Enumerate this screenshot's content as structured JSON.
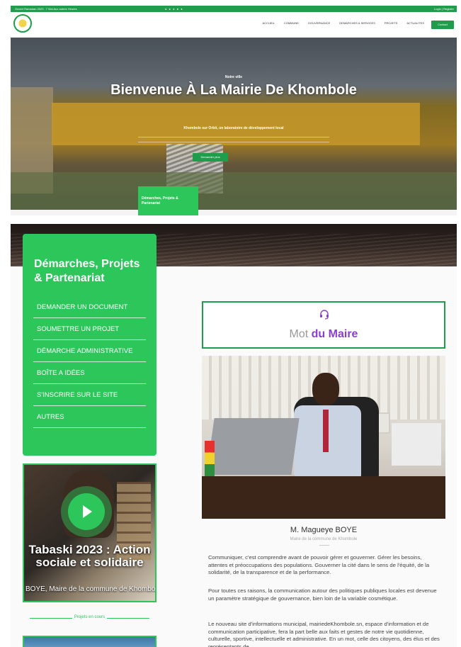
{
  "topbar": {
    "left_text": "Ouvert Ramadan 2023 : 7 Mai Aux autres Heures",
    "social_icons": [
      "facebook-icon",
      "twitter-icon",
      "instagram-icon",
      "youtube-icon",
      "linkedin-icon"
    ],
    "right_text": "Login | Register"
  },
  "navbar": {
    "items": [
      "ACCUEIL",
      "COMMUNE",
      "GOUVERNANCE",
      "DEMARCHES & SERVICES",
      "PROJETS",
      "ACTUALITES"
    ],
    "cta_label": "Contact"
  },
  "hero": {
    "small_title": "Notre ville",
    "title": "Bienvenue À La Mairie De Khombole",
    "tagline": "Khombole sur Orbit, un laboratoire de développement local",
    "button_label": "Demander plus",
    "tab_label": "Démarches, Projets & Partenariat"
  },
  "sidebar": {
    "title": "Démarches, Projets & Partenariat",
    "items": [
      "DEMANDER UN DOCUMENT",
      "SOUMETTRE UN PROJET",
      "DÉMARCHE ADMINISTRATIVE",
      "BOÎTE A IDÉES",
      "S'INSCRIRE SUR LE SITE",
      "AUTRES"
    ]
  },
  "video": {
    "title": "Tabaski 2023 : Action sociale et solidaire",
    "caption": "BOYE, Maire de la commune de Khombole"
  },
  "projets_label": "Projets en cours",
  "mot": {
    "prefix": "Mot",
    "highlight": "du Maire"
  },
  "mayor": {
    "name": "M. Magueye BOYE",
    "role": "Maire de la commune de Khombole"
  },
  "paragraphs": [
    "Communiquer, c'est comprendre avant de pouvoir gérer et gouverner. Gérer les besoins, attentes et préoccupations des populations. Gouverner la cité dans le sens de l'équité, de la solidarité, de la transparence et de la performance.",
    "Pour toutes ces raisons, la communication autour des politiques publiques locales est devenue un paramètre stratégique de gouvernance, bien loin de la variable cosmétique.",
    "Le nouveau site d'informations municipal, mairiedeKhombole.sn, espace d'information et de communication participative, fera la part belle aux faits et gestes de notre vie quotidienne, culturelle, sportive, intellectuelle et administrative. En un mot, celle des citoyens, des élus et des représentants de"
  ],
  "colors": {
    "green": "#2dc65a",
    "dark_green": "#1f9d4c",
    "purple": "#8b3fd1"
  }
}
